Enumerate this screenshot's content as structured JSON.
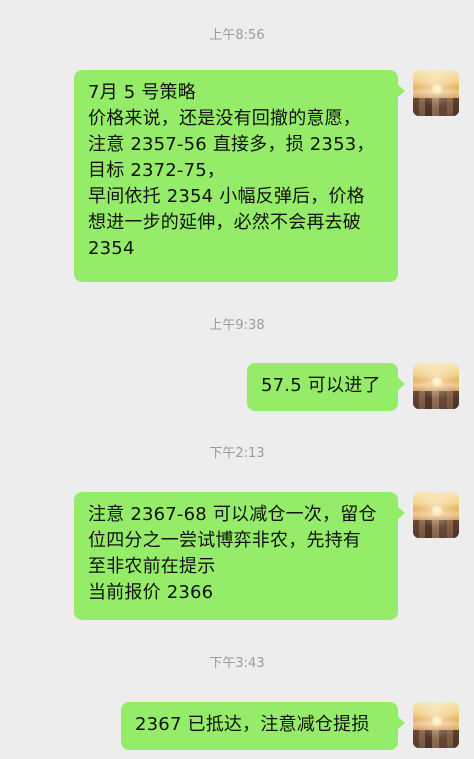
{
  "chat": {
    "colors": {
      "background": "#ededed",
      "bubble_green": "#95ec69",
      "timestamp_gray": "#9b9b9b",
      "text": "#111111"
    },
    "timestamps": [
      {
        "text": "上午8:56"
      },
      {
        "text": "上午9:38"
      },
      {
        "text": "下午2:13"
      },
      {
        "text": "下午3:43"
      }
    ],
    "messages": [
      {
        "text": "7月 5 号策略\n价格来说，还是没有回撤的意愿，\n注意 2357-56 直接多，损 2353，\n目标 2372-75，\n早间依托 2354 小幅反弹后，价格\n想进一步的延伸，必然不会再去破\n2354"
      },
      {
        "text": "57.5 可以进了"
      },
      {
        "text": "注意 2367-68 可以减仓一次，留仓\n位四分之一尝试博弈非农，先持有\n至非农前在提示\n当前报价 2366"
      },
      {
        "text": "2367 已抵达，注意减仓提损"
      }
    ],
    "avatar": {
      "icon": "sunset-city-avatar"
    }
  }
}
